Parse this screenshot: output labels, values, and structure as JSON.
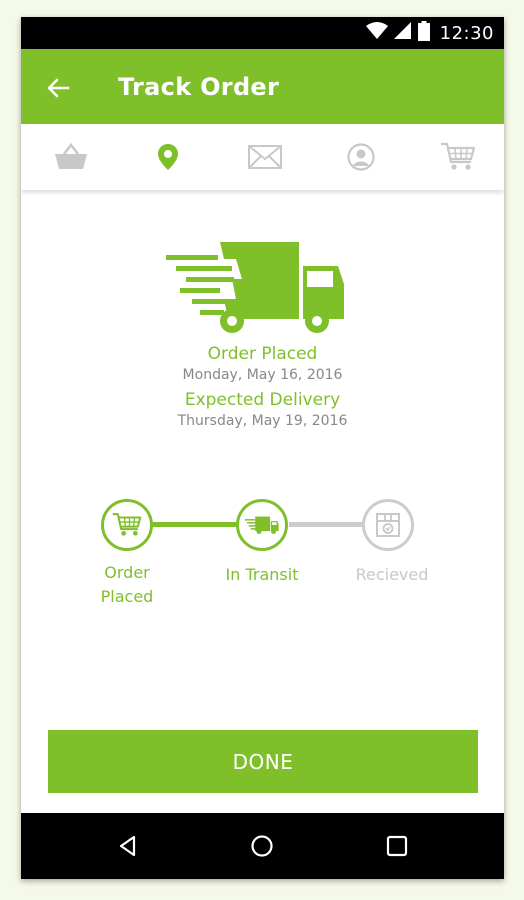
{
  "status_bar": {
    "time": "12:30"
  },
  "app_bar": {
    "title": "Track Order"
  },
  "tabs": [
    {
      "icon": "basket-icon",
      "active": false
    },
    {
      "icon": "location-pin-icon",
      "active": true
    },
    {
      "icon": "mail-icon",
      "active": false
    },
    {
      "icon": "account-icon",
      "active": false
    },
    {
      "icon": "cart-icon",
      "active": false
    }
  ],
  "order": {
    "placed_label": "Order Placed",
    "placed_date": "Monday, May 16, 2016",
    "expected_label": "Expected Delivery",
    "expected_date": "Thursday, May 19, 2016"
  },
  "tracker": {
    "steps": [
      {
        "label_line1": "Order",
        "label_line2": "Placed",
        "icon": "cart-icon",
        "state": "done"
      },
      {
        "label_line1": "In Transit",
        "label_line2": "",
        "icon": "truck-icon",
        "state": "current"
      },
      {
        "label_line1": "Recieved",
        "label_line2": "",
        "icon": "box-icon",
        "state": "pending"
      }
    ]
  },
  "done_button": {
    "label": "DONE"
  },
  "colors": {
    "accent": "#7fbf2a",
    "inactive": "#cccccc",
    "text_gray": "#888888"
  }
}
